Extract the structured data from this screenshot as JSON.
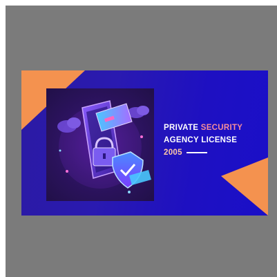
{
  "banner": {
    "line1_main": "PRIVATE",
    "line1_accent": "SECURITY",
    "line2": "AGENCY LICENSE",
    "year": "2005"
  },
  "colors": {
    "frame_background": "#7b7b7b",
    "banner_gradient_start": "#2b1aa3",
    "banner_gradient_end": "#1a0fc8",
    "corner_triangles": "#f4924f",
    "accent_text": "#f58d9b",
    "illustration_glow": "#c04bff"
  },
  "icons": [
    "phone-icon",
    "cloud-icon",
    "credit-card-icon",
    "shield-check-icon",
    "padlock-icon"
  ]
}
